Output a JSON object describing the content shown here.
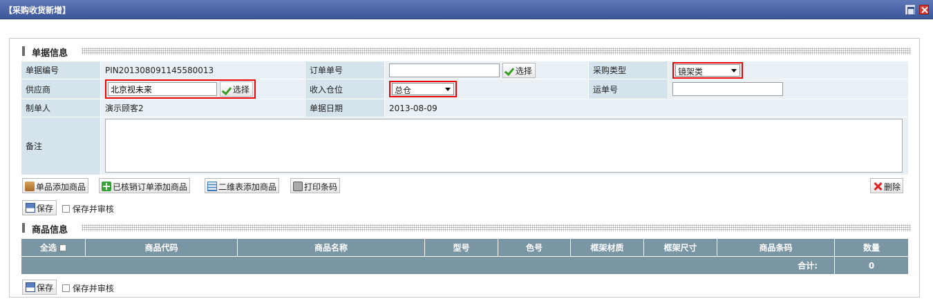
{
  "window": {
    "title": "【采购收货新增】"
  },
  "sections": {
    "doc_info": "单据信息",
    "goods_info": "商品信息"
  },
  "form": {
    "doc_no_label": "单据编号",
    "doc_no_value": "PIN2013080911455800​13",
    "order_no_label": "订单单号",
    "order_no_value": "",
    "purchase_type_label": "采购类型",
    "purchase_type_value": "镜架类",
    "supplier_label": "供应商",
    "supplier_value": "北京视未来",
    "warehouse_label": "收入仓位",
    "warehouse_value": "总仓",
    "waybill_label": "运单号",
    "waybill_value": "",
    "creator_label": "制单人",
    "creator_value": "演示顾客2",
    "doc_date_label": "单据日期",
    "doc_date_value": "2013-08-09",
    "remark_label": "备注",
    "remark_value": "",
    "select_label": "选择"
  },
  "toolbar": {
    "add_single": "单品添加商品",
    "add_from_order": "已核销订单添加商品",
    "add_matrix": "二维表添加商品",
    "print_barcode": "打印条码",
    "delete": "删除"
  },
  "save": {
    "save_label": "保存",
    "save_audit_label": "保存并审核"
  },
  "grid": {
    "columns": [
      "全选",
      "商品代码",
      "商品名称",
      "型号",
      "色号",
      "框架材质",
      "框架尺寸",
      "商品条码",
      "数量"
    ],
    "total_label": "合计:",
    "total_qty": "0"
  },
  "colors": {
    "titlebar": "#3d579b",
    "highlight": "#ee0000",
    "grid_header": "#7a95a4",
    "label_cell": "#d4e3ec"
  }
}
